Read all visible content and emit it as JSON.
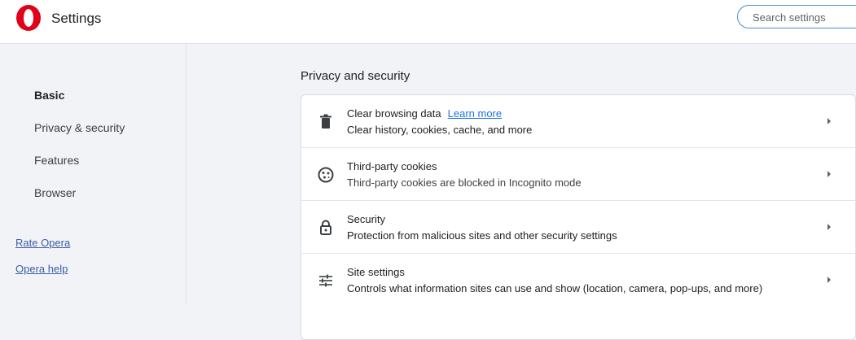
{
  "header": {
    "title": "Settings",
    "search_placeholder": "Search settings",
    "brand_color": "#e0001a"
  },
  "sidebar": {
    "items": [
      {
        "label": "Basic",
        "active": true
      },
      {
        "label": "Privacy & security",
        "active": false
      },
      {
        "label": "Features",
        "active": false
      },
      {
        "label": "Browser",
        "active": false
      }
    ],
    "links": [
      {
        "label": "Rate Opera"
      },
      {
        "label": "Opera help"
      }
    ]
  },
  "main": {
    "section_title": "Privacy and security",
    "rows": [
      {
        "icon": "trash-icon",
        "title": "Clear browsing data",
        "link": "Learn more",
        "subtitle": "Clear history, cookies, cache, and more"
      },
      {
        "icon": "cookie-icon",
        "title": "Third-party cookies",
        "subtitle": "Third-party cookies are blocked in Incognito mode"
      },
      {
        "icon": "lock-icon",
        "title": "Security",
        "subtitle": "Protection from malicious sites and other security settings"
      },
      {
        "icon": "sliders-icon",
        "title": "Site settings",
        "subtitle": "Controls what information sites can use and show (location, camera, pop-ups, and more)"
      }
    ]
  }
}
